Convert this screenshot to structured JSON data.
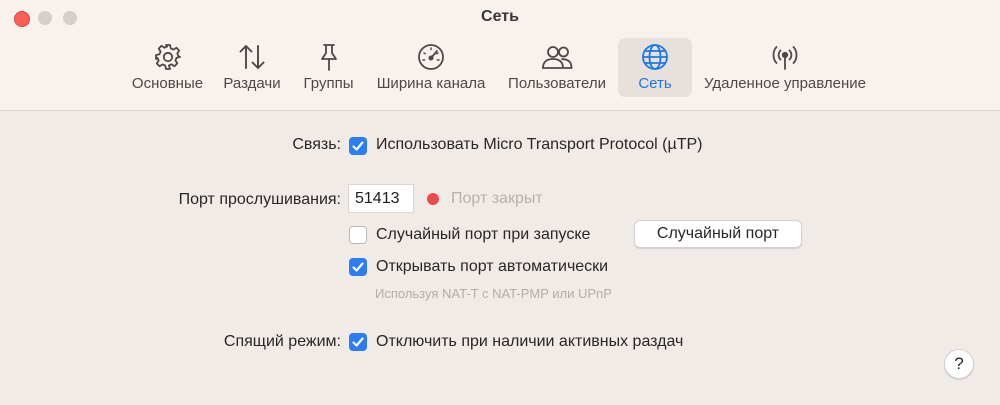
{
  "window": {
    "title": "Сеть"
  },
  "tabs": [
    {
      "label": "Основные",
      "icon": "gear-icon"
    },
    {
      "label": "Раздачи",
      "icon": "transfer-arrows-icon"
    },
    {
      "label": "Группы",
      "icon": "pin-icon"
    },
    {
      "label": "Ширина канала",
      "icon": "gauge-icon"
    },
    {
      "label": "Пользователи",
      "icon": "users-icon"
    },
    {
      "label": "Сеть",
      "icon": "globe-icon",
      "selected": true
    },
    {
      "label": "Удаленное управление",
      "icon": "antenna-icon"
    }
  ],
  "connection": {
    "label": "Связь:",
    "utp_label": "Использовать Micro Transport Protocol (µTP)",
    "utp_checked": true
  },
  "port": {
    "label": "Порт прослушивания:",
    "value": "51413",
    "status_text": "Порт закрыт",
    "status_color": "#ed4a4a",
    "random_on_start_label": "Случайный порт при запуске",
    "random_on_start_checked": false,
    "random_button": "Случайный порт",
    "auto_open_label": "Открывать порт автоматически",
    "auto_open_checked": true,
    "auto_open_hint": "Используя NAT-T с NAT-PMP или UPnP"
  },
  "sleep": {
    "label": "Спящий режим:",
    "prevent_label": "Отключить при наличии активных раздач",
    "prevent_checked": true
  },
  "help": {
    "label": "?"
  },
  "colors": {
    "accent": "#2b7df3",
    "selected_tab_text": "#1d77e6",
    "close_button": "#fe5f57"
  }
}
